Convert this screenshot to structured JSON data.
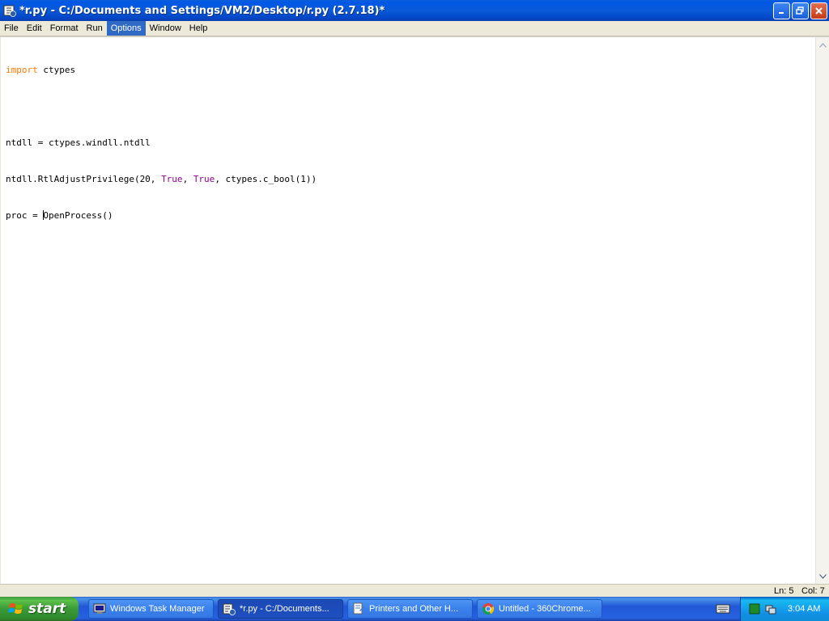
{
  "window": {
    "title": "*r.py - C:/Documents and Settings/VM2/Desktop/r.py (2.7.18)*",
    "icon": "python-idle-icon"
  },
  "menu": {
    "items": [
      {
        "label": "File"
      },
      {
        "label": "Edit"
      },
      {
        "label": "Format"
      },
      {
        "label": "Run"
      },
      {
        "label": "Options"
      },
      {
        "label": "Window"
      },
      {
        "label": "Help"
      }
    ],
    "active_item": "Options"
  },
  "editor": {
    "lines": {
      "l1_kw": "import",
      "l1_rest": " ctypes",
      "l3": "ntdll = ctypes.windll.ntdll",
      "l4_a": "ntdll.RtlAdjustPrivilege(20, ",
      "l4_true1": "True",
      "l4_b": ", ",
      "l4_true2": "True",
      "l4_c": ", ctypes.c_bool(1))",
      "l5_a": "proc = ",
      "l5_b": "OpenProcess()"
    },
    "keyword_color": "#ff7700",
    "builtin_color": "#900090"
  },
  "status": {
    "ln": "Ln: 5",
    "col": "Col: 7"
  },
  "taskbar": {
    "start_label": "start",
    "tasks": [
      {
        "label": "Windows Task Manager",
        "icon": "task-manager-icon"
      },
      {
        "label": "*r.py - C:/Documents...",
        "icon": "idle-icon"
      },
      {
        "label": "Printers and Other H...",
        "icon": "printer-icon"
      },
      {
        "label": "Untitled - 360Chrome...",
        "icon": "browser-icon"
      }
    ],
    "clock": "3:04 AM"
  }
}
